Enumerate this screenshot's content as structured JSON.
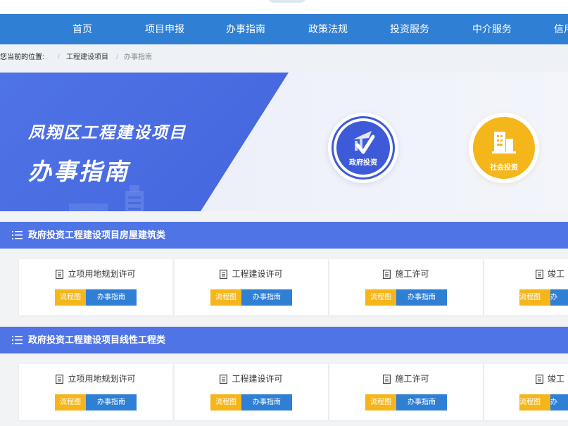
{
  "nav": {
    "items": [
      "首页",
      "项目申报",
      "办事指南",
      "政策法规",
      "投资服务",
      "中介服务",
      "信用"
    ]
  },
  "breadcrumb": {
    "label": "您当前的位置:",
    "items": [
      "工程建设项目",
      "办事指南"
    ]
  },
  "banner": {
    "title_line1": "凤翔区工程建设项目",
    "title_line2": "办事指南",
    "buttons": [
      {
        "label": "政府投资",
        "icon": "government-investment-icon",
        "color": "#3d5bd8"
      },
      {
        "label": "社会投资",
        "icon": "social-investment-icon",
        "color": "#f4b61a"
      }
    ]
  },
  "sections": [
    {
      "title": "政府投资工程建设项目房屋建筑类",
      "cards": [
        {
          "title": "立项用地规划许可",
          "flow_label": "流程图",
          "guide_label": "办事指南"
        },
        {
          "title": "工程建设许可",
          "flow_label": "流程图",
          "guide_label": "办事指南"
        },
        {
          "title": "施工许可",
          "flow_label": "流程图",
          "guide_label": "办事指南"
        },
        {
          "title": "竣工",
          "flow_label": "流程图",
          "guide_label": "办"
        }
      ]
    },
    {
      "title": "政府投资工程建设项目线性工程类",
      "cards": [
        {
          "title": "立项用地规划许可",
          "flow_label": "流程图",
          "guide_label": "办事指南"
        },
        {
          "title": "工程建设许可",
          "flow_label": "流程图",
          "guide_label": "办事指南"
        },
        {
          "title": "施工许可",
          "flow_label": "流程图",
          "guide_label": "办事指南"
        },
        {
          "title": "竣工",
          "flow_label": "流程图",
          "guide_label": "办"
        }
      ]
    }
  ],
  "colors": {
    "nav_bg": "#2f7fd5",
    "section_bg": "#4f74e6",
    "flow_btn": "#f4b61a",
    "guide_btn": "#2f7fd5"
  }
}
